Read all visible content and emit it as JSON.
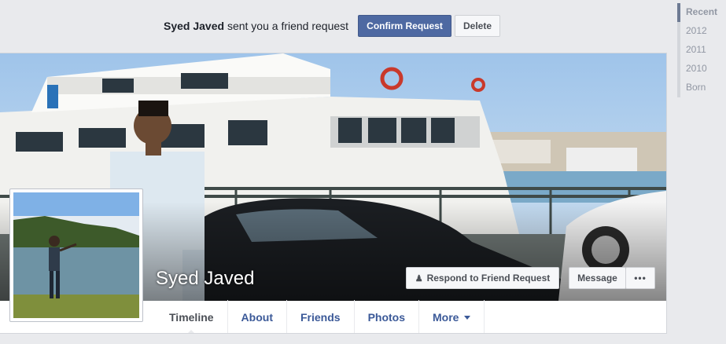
{
  "friend_request": {
    "sender": "Syed Javed",
    "message": "sent you a friend request",
    "confirm_label": "Confirm Request",
    "delete_label": "Delete"
  },
  "scrubber": {
    "items": [
      "Recent",
      "2012",
      "2011",
      "2010",
      "Born"
    ]
  },
  "profile": {
    "name": "Syed Javed",
    "respond_label": "Respond to Friend Request",
    "message_label": "Message",
    "more_label": "•••"
  },
  "tabs": [
    "Timeline",
    "About",
    "Friends",
    "Photos",
    "More"
  ],
  "colors": {
    "brand_blue": "#3b5998",
    "confirm_button": "#4e69a2",
    "page_background": "#e9eaed"
  }
}
